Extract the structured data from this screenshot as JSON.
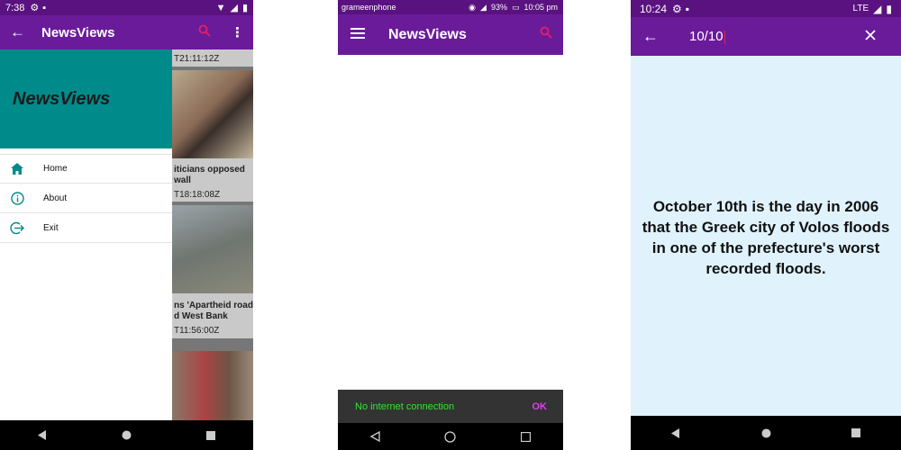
{
  "colors": {
    "appbar": "#6a1b9a",
    "accent": "#e91e63",
    "drawer_header": "#008b8b",
    "snackbar_text": "#2ee82e",
    "snackbar_action": "#e43cf0"
  },
  "screen1": {
    "status": {
      "time": "7:38"
    },
    "appbar": {
      "title": "NewsViews"
    },
    "drawer": {
      "header_title": "NewsViews",
      "items": [
        {
          "label": "Home",
          "icon": "home-icon"
        },
        {
          "label": "About",
          "icon": "info-icon"
        },
        {
          "label": "Exit",
          "icon": "exit-icon"
        }
      ]
    },
    "feed_fragments": {
      "t1": "T21:11:12Z",
      "title1_l1": "iticians opposed",
      "title1_l2": "wall",
      "t2": "T18:18:08Z",
      "title2_l1": "ns 'Apartheid road'",
      "title2_l2": "d West Bank",
      "t3": "T11:56:00Z"
    }
  },
  "screen2": {
    "status": {
      "carrier": "grameenphone",
      "battery": "93%",
      "time": "10:05 pm"
    },
    "appbar": {
      "title": "NewsViews"
    },
    "snackbar": {
      "message": "No internet connection",
      "action": "OK"
    }
  },
  "screen3": {
    "status": {
      "time": "10:24",
      "network": "LTE"
    },
    "search": {
      "value": "10/10"
    },
    "fact": {
      "line1": "October 10th is the day in 2006",
      "line2": "that the Greek city of Volos floods",
      "line3": "in one of the prefecture's worst",
      "line4": "recorded floods."
    }
  }
}
